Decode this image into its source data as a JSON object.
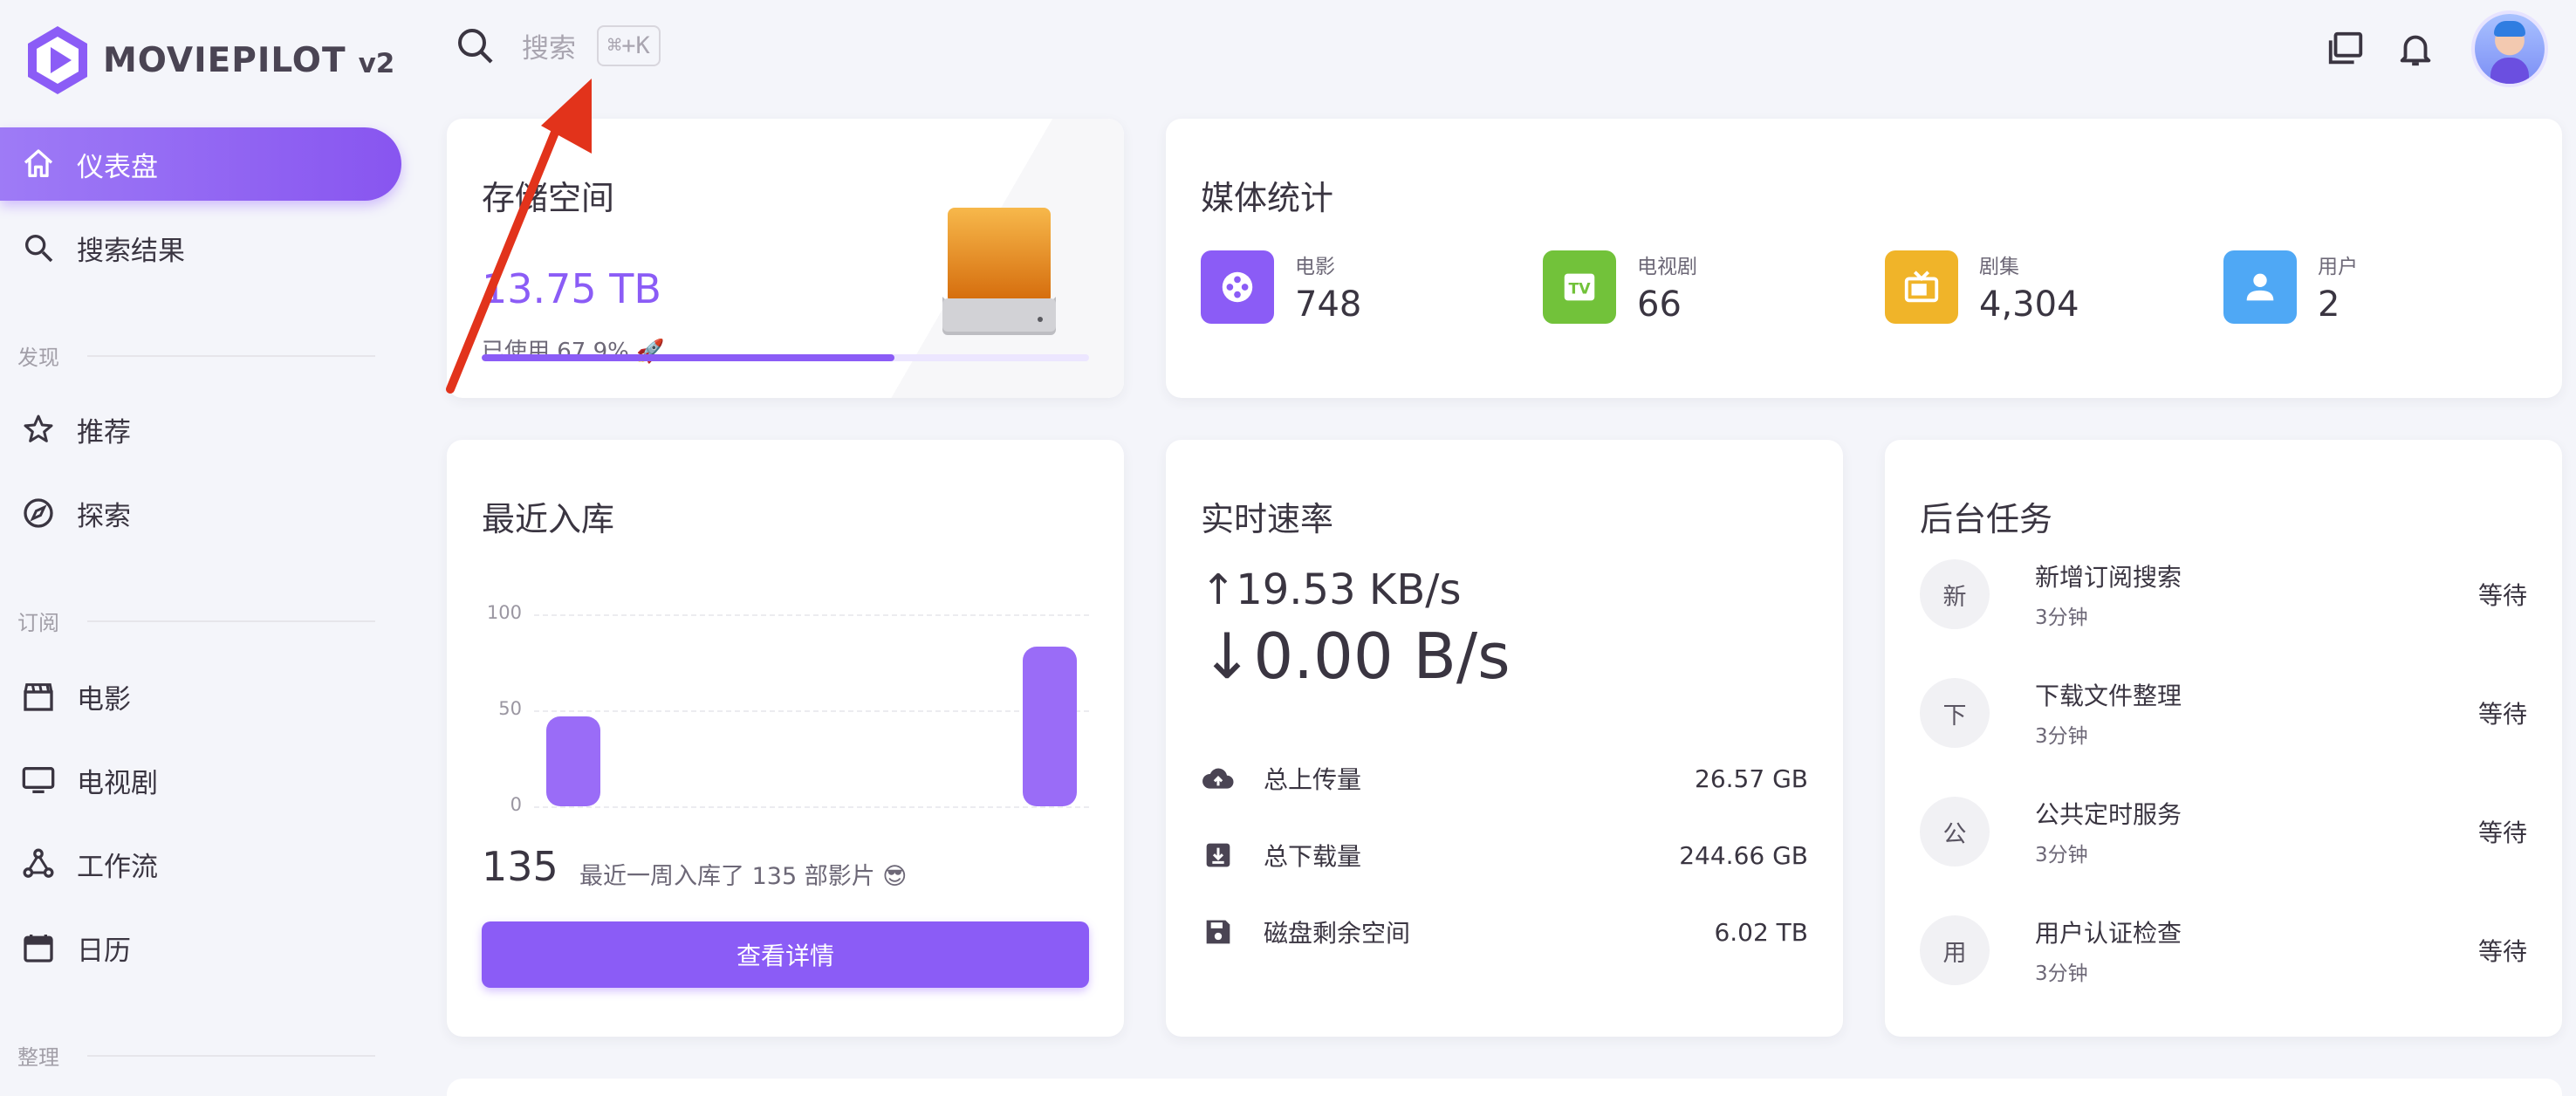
{
  "app": {
    "name": "MOVIEPILOT",
    "version": "v2"
  },
  "search": {
    "placeholder": "搜索",
    "shortcut": "⌘+K"
  },
  "sidebar": {
    "items": [
      {
        "label": "仪表盘",
        "icon": "home-icon",
        "active": true
      },
      {
        "label": "搜索结果",
        "icon": "search-icon"
      }
    ],
    "sections": [
      {
        "title": "发现",
        "items": [
          {
            "label": "推荐",
            "icon": "star-icon"
          },
          {
            "label": "探索",
            "icon": "compass-icon"
          }
        ]
      },
      {
        "title": "订阅",
        "items": [
          {
            "label": "电影",
            "icon": "clapper-icon"
          },
          {
            "label": "电视剧",
            "icon": "monitor-icon"
          },
          {
            "label": "工作流",
            "icon": "workflow-icon"
          },
          {
            "label": "日历",
            "icon": "calendar-icon"
          }
        ]
      },
      {
        "title": "整理",
        "items": []
      }
    ]
  },
  "storage": {
    "title": "存储空间",
    "total": "13.75 TB",
    "used_text": "已使用 67.9% 🚀",
    "used_percent": 67.9
  },
  "media": {
    "title": "媒体统计",
    "stats": [
      {
        "label": "电影",
        "value": "748",
        "color": "#8b5cf6",
        "icon": "film-reel-icon"
      },
      {
        "label": "电视剧",
        "value": "66",
        "color": "#72c23a",
        "icon": "tv-logo-icon"
      },
      {
        "label": "剧集",
        "value": "4,304",
        "color": "#f0b429",
        "icon": "television-icon"
      },
      {
        "label": "用户",
        "value": "2",
        "color": "#4fa8f5",
        "icon": "user-icon"
      }
    ]
  },
  "recent": {
    "title": "最近入库",
    "count": "135",
    "description": "最近一周入库了 135 部影片 😎",
    "button": "查看详情",
    "chart_data": {
      "type": "bar",
      "categories": [
        "",
        "",
        "",
        "",
        "",
        "",
        ""
      ],
      "values": [
        47,
        0,
        0,
        0,
        0,
        0,
        83
      ],
      "ylim": [
        0,
        100
      ],
      "yticks": [
        "100",
        "50",
        "0"
      ]
    }
  },
  "speed": {
    "title": "实时速率",
    "upload": "↑19.53 KB/s",
    "download": "↓0.00 B/s",
    "rows": [
      {
        "label": "总上传量",
        "value": "26.57 GB",
        "icon": "cloud-upload-icon"
      },
      {
        "label": "总下载量",
        "value": "244.66 GB",
        "icon": "download-box-icon"
      },
      {
        "label": "磁盘剩余空间",
        "value": "6.02 TB",
        "icon": "floppy-disk-icon"
      }
    ]
  },
  "tasks": {
    "title": "后台任务",
    "items": [
      {
        "initial": "新",
        "name": "新增订阅搜索",
        "time": "3分钟",
        "status": "等待"
      },
      {
        "initial": "下",
        "name": "下载文件整理",
        "time": "3分钟",
        "status": "等待"
      },
      {
        "initial": "公",
        "name": "公共定时服务",
        "time": "3分钟",
        "status": "等待"
      },
      {
        "initial": "用",
        "name": "用户认证检查",
        "time": "3分钟",
        "status": "等待"
      }
    ]
  }
}
